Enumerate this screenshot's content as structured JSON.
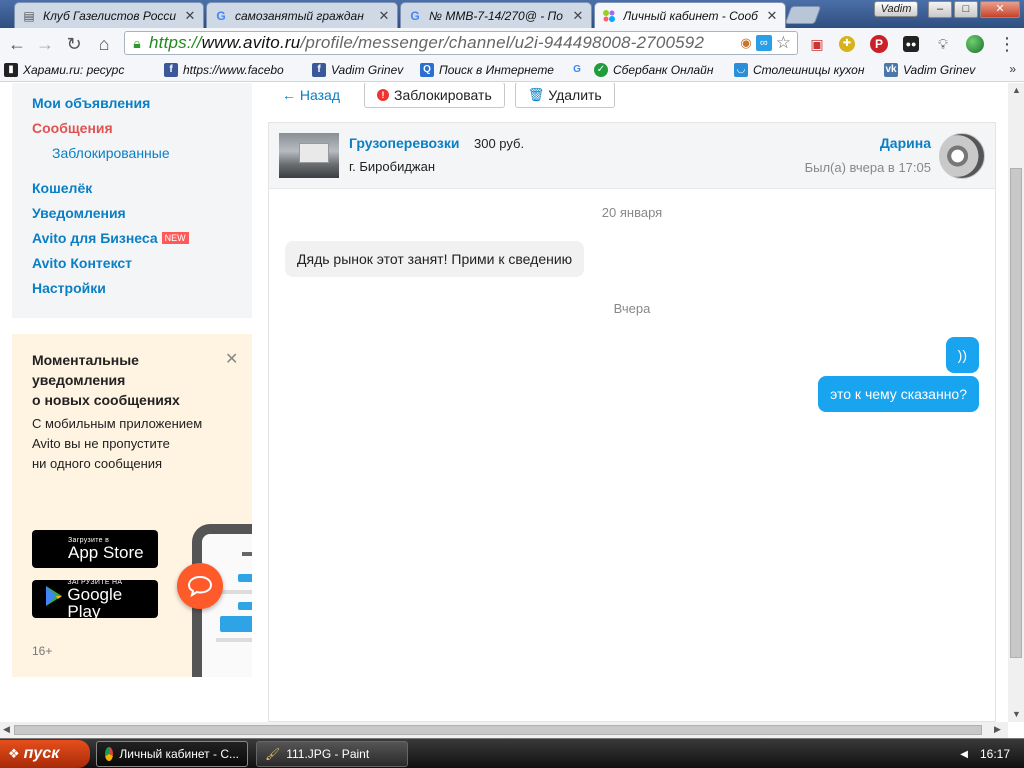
{
  "browser": {
    "tabs": [
      {
        "label": "Клуб Газелистов Росси",
        "icon": "forum-favicon",
        "active": false
      },
      {
        "label": "самозанятый граждан",
        "icon": "google-favicon",
        "active": false
      },
      {
        "label": "№ ММВ-7-14/270@ - По",
        "icon": "google-favicon",
        "active": false
      },
      {
        "label": "Личный кабинет - Сооб",
        "icon": "avito-favicon",
        "active": true
      }
    ],
    "profile_name": "Vadim",
    "window_controls": {
      "minimize": "–",
      "maximize": "□",
      "close": "✕"
    },
    "url": {
      "scheme": "https://",
      "host": "www.avito.ru",
      "path": "/profile/messenger/channel/u2i-944498008-2700592"
    },
    "bookmarks": [
      {
        "label": "Харами.ru: ресурс",
        "icon": "harami-icon",
        "color": "#222222"
      },
      {
        "label": "https://www.facebo",
        "icon": "facebook-icon",
        "color": "#3b5998"
      },
      {
        "label": "Vadim Grinev",
        "icon": "facebook-icon",
        "color": "#3b5998"
      },
      {
        "label": "Поиск в Интернете",
        "icon": "search-icon",
        "color": "#2a6fd1"
      },
      {
        "label": "Сбербанк Онлайн",
        "icon": "sberbank-icon",
        "color": "#1f9d3c"
      },
      {
        "label": "Столешницы кухон",
        "icon": "basket-icon",
        "color": "#2a8fd8"
      },
      {
        "label": "Vadim Grinev",
        "icon": "vk-icon",
        "color": "#4a76a8"
      }
    ]
  },
  "sidebar": {
    "items": [
      {
        "label": "Мои объявления",
        "active": false
      },
      {
        "label": "Сообщения",
        "active": true
      },
      {
        "label": "Заблокированные",
        "sub": true
      },
      {
        "label": "Кошелёк"
      },
      {
        "label": "Уведомления"
      },
      {
        "label": "Avito для Бизнеса",
        "badge": "NEW"
      },
      {
        "label": "Avito Контекст"
      },
      {
        "label": "Настройки"
      }
    ]
  },
  "promo": {
    "title_lines": [
      "Моментальные",
      "уведомления",
      "о новых сообщениях"
    ],
    "body_lines": [
      "С мобильным приложением",
      "Avito вы не пропустите",
      "ни одного сообщения"
    ],
    "app_store": {
      "small": "Загрузите в",
      "big": "App Store"
    },
    "google_play": {
      "small": "ЗАГРУЗИТЕ НА",
      "big": "Google Play"
    },
    "age": "16+"
  },
  "chat_toolbar": {
    "back": "← Назад",
    "block": "Заблокировать",
    "delete": "Удалить"
  },
  "chat": {
    "ad_title": "Грузоперевозки",
    "ad_price": "300 руб.",
    "ad_city": "г. Биробиджан",
    "user_name": "Дарина",
    "user_seen": "Был(а) вчера в 17:05",
    "messages": [
      {
        "type": "date",
        "text": "20 января"
      },
      {
        "type": "in",
        "text": "Дядь рынок этот занят! Прими к сведению"
      },
      {
        "type": "date",
        "text": "Вчера"
      },
      {
        "type": "out",
        "text": "))"
      },
      {
        "type": "out",
        "text": "это к чему сказанно?"
      }
    ]
  },
  "taskbar": {
    "start": "пуск",
    "tasks": [
      {
        "label": "Личный кабинет - C...",
        "active": true
      },
      {
        "label": "111.JPG - Paint",
        "active": false
      }
    ],
    "clock": "16:17"
  },
  "colors": {
    "link": "#0a7fc4",
    "active_menu": "#e05353",
    "out_bubble": "#19a4ef",
    "promo_bg": "#fff3e2"
  }
}
